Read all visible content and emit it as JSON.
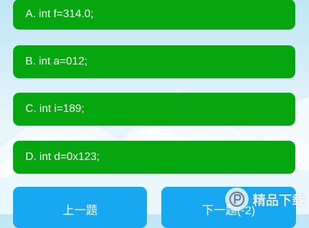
{
  "options": [
    {
      "id": "a",
      "text": "A. int f=314.0;"
    },
    {
      "id": "b",
      "text": "B. int a=012;"
    },
    {
      "id": "c",
      "text": "C. int i=189;"
    },
    {
      "id": "d",
      "text": "D. int d=0x123;"
    }
  ],
  "navigation": {
    "prev_label": "上一题",
    "next_label": "下一题(-2)"
  },
  "watermark": {
    "text": "精品下载"
  },
  "colors": {
    "option_green": "#05a60f",
    "nav_blue": "#18a7f1",
    "background_sky": "#d7eff8"
  }
}
